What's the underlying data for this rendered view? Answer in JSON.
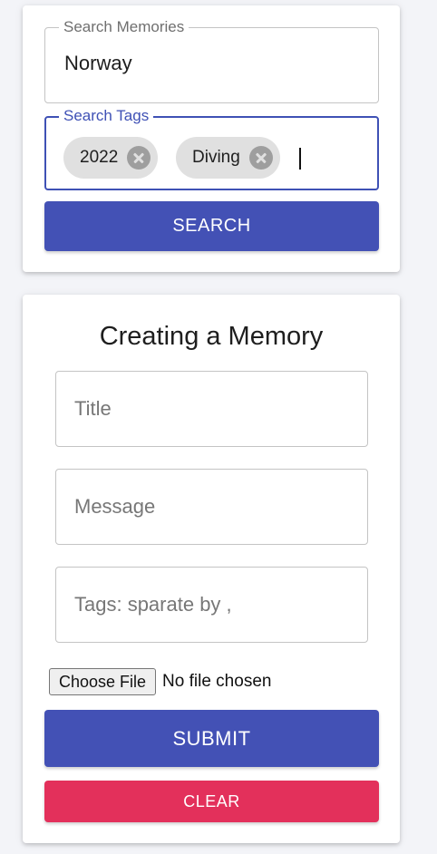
{
  "search": {
    "memories_label": "Search Memories",
    "memories_value": "Norway",
    "tags_label": "Search Tags",
    "tags": [
      "2022",
      "Diving"
    ],
    "button_label": "SEARCH"
  },
  "form": {
    "title": "Creating a Memory",
    "title_placeholder": "Title",
    "message_placeholder": "Message",
    "tags_placeholder": "Tags: sparate by ,",
    "file_button_label": "Choose File",
    "file_status": "No file chosen",
    "submit_label": "SUBMIT",
    "clear_label": "CLEAR"
  },
  "colors": {
    "primary": "#4351b5",
    "secondary": "#e3305b",
    "focus_outline": "#3f51b5",
    "chip": "#e0e0e0"
  }
}
